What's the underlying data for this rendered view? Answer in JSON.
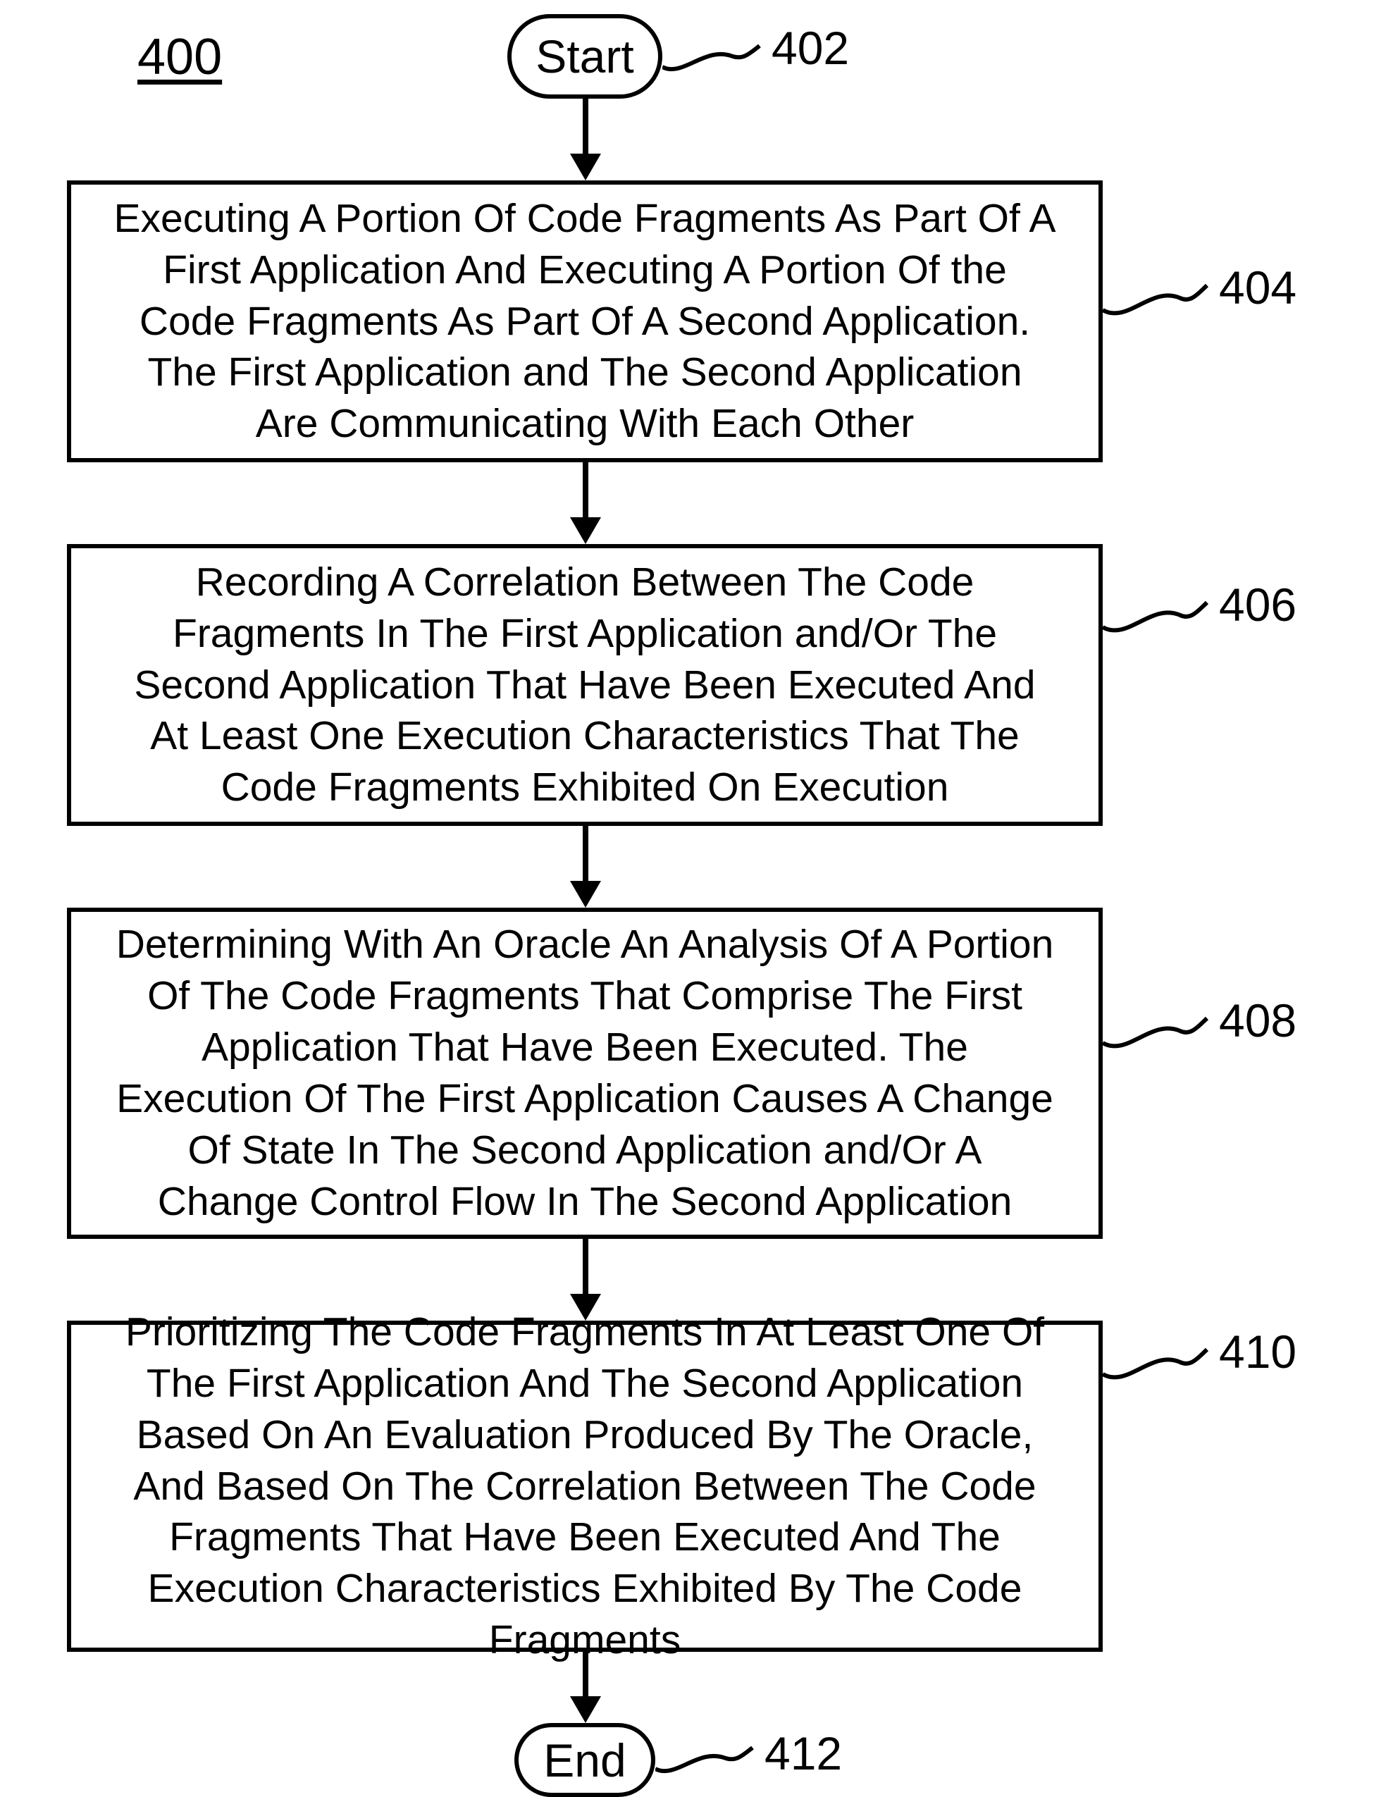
{
  "figure_number": "400",
  "start": {
    "label": "Start",
    "ref": "402"
  },
  "steps": [
    {
      "ref": "404",
      "text": "Executing A Portion Of Code Fragments As Part Of A First Application And Executing A Portion Of the Code Fragments As Part Of A Second Application. The First Application and The Second Application Are Communicating With Each Other"
    },
    {
      "ref": "406",
      "text": "Recording A Correlation Between The Code Fragments In The First Application and/Or The Second Application That Have Been Executed And At Least One Execution Characteristics That The Code Fragments Exhibited On Execution"
    },
    {
      "ref": "408",
      "text": "Determining With An Oracle An Analysis Of A Portion Of The Code Fragments That Comprise The First Application That Have Been Executed. The Execution Of The First Application Causes A Change Of State In The Second Application and/Or A Change Control Flow In The Second Application"
    },
    {
      "ref": "410",
      "text": "Prioritizing The Code Fragments In At Least One Of The First Application And The Second Application Based On An Evaluation Produced By The Oracle, And Based On The Correlation Between The Code Fragments That Have Been Executed And The Execution Characteristics Exhibited By The Code Fragments"
    }
  ],
  "end": {
    "label": "End",
    "ref": "412"
  }
}
